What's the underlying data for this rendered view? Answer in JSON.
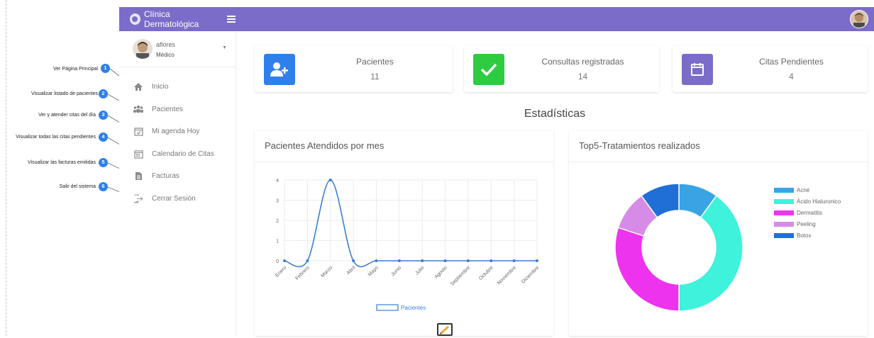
{
  "app": {
    "title": "Clínica Dermatológica"
  },
  "user": {
    "name": "aflores",
    "role": "Médico"
  },
  "sidebar": {
    "items": [
      {
        "label": "Inicio",
        "icon": "home-icon"
      },
      {
        "label": "Pacientes",
        "icon": "users-icon"
      },
      {
        "label": "Mi agenda Hoy",
        "icon": "calendar-check-icon"
      },
      {
        "label": "Calendario de Citas",
        "icon": "calendar-icon"
      },
      {
        "label": "Facturas",
        "icon": "invoice-icon"
      },
      {
        "label": "Cerrar Sesión",
        "icon": "logout-icon"
      }
    ]
  },
  "annotations": [
    {
      "number": "1",
      "text": "Ver Página Principal"
    },
    {
      "number": "2",
      "text": "Visualizar listado de pacientes"
    },
    {
      "number": "3",
      "text": "Ver y atender citas del día"
    },
    {
      "number": "4",
      "text": "Visualizar todas las citas pendientes"
    },
    {
      "number": "5",
      "text": "Visualizar las facturas emitidas"
    },
    {
      "number": "6",
      "text": "Salir del sistema"
    }
  ],
  "stats": [
    {
      "label": "Pacientes",
      "value": "11",
      "color": "#2f80ed",
      "icon": "add-user-icon"
    },
    {
      "label": "Consultas registradas",
      "value": "14",
      "color": "#2ecc40",
      "icon": "check-icon"
    },
    {
      "label": "Citas Pendientes",
      "value": "4",
      "color": "#7b6cc9",
      "icon": "calendar-icon"
    }
  ],
  "section_title": "Estadísticas",
  "colors": {
    "topbar": "#7b6cc9",
    "annotation_badge": "#2f80ed",
    "line": "#3a7fd5"
  },
  "chart_data": [
    {
      "type": "line",
      "title": "Pacientes Atendidos por mes",
      "categories": [
        "Enero",
        "Febrero",
        "Marzo",
        "Abril",
        "Mayo",
        "Junio",
        "Julio",
        "Agosto",
        "Septiembre",
        "Octubre",
        "Noviembre",
        "Diciembre"
      ],
      "series": [
        {
          "name": "Pacientes",
          "values": [
            0,
            0,
            4,
            0,
            0,
            0,
            0,
            0,
            0,
            0,
            0,
            0
          ]
        }
      ],
      "yticks": [
        "0",
        "1",
        "2",
        "3",
        "4"
      ],
      "ylim": [
        0,
        4
      ],
      "grid": true,
      "legend": "bottom"
    },
    {
      "type": "pie",
      "title": "Top5-Tratamientos realizados",
      "labels": [
        "Acné",
        "Ácido Hialuronico",
        "Dermatitis",
        "Peeling",
        "Botox"
      ],
      "values": [
        10,
        40,
        30,
        10,
        10
      ],
      "colors": [
        "#3aa3e3",
        "#3ef2dc",
        "#ee33ee",
        "#d68be6",
        "#1f6fd6"
      ],
      "legend": "right"
    }
  ]
}
